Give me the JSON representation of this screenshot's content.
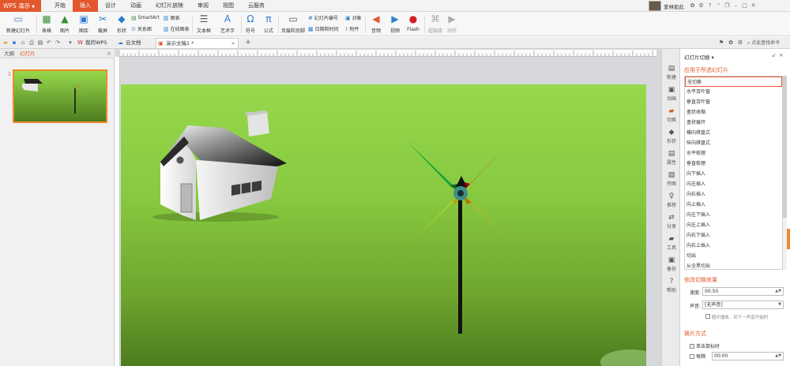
{
  "app": {
    "name": "WPS 演示"
  },
  "menu": {
    "tabs": [
      "开始",
      "插入",
      "设计",
      "动画",
      "幻灯片放映",
      "审阅",
      "视图",
      "云服务"
    ],
    "active_index": 1
  },
  "user": {
    "name": "爱林如此"
  },
  "ribbon": {
    "new_slide": "新建幻灯片",
    "table": "表格",
    "picture": "图片",
    "gallery": "图库",
    "screenshot": "截屏",
    "shapes": "形状",
    "smartart": "SmartArt",
    "chart": "图表",
    "relation": "关系图",
    "online_chart": "在线图表",
    "textbox": "文本框",
    "wordart": "艺术字",
    "symbol": "符号",
    "formula": "公式",
    "header_footer": "页眉和页脚",
    "slide_number": "幻灯片编号",
    "object": "对象",
    "datetime": "日期和时间",
    "attachment": "附件",
    "audio": "音频",
    "video": "视频",
    "flash": "Flash",
    "hyperlink": "超链接",
    "action": "动作"
  },
  "doc_tabs": {
    "tabs": [
      "我的WPS",
      "云文档",
      "演示文稿1 *"
    ],
    "active_index": 2,
    "search": "点此查找命令"
  },
  "thumbnail_panel": {
    "tabs": [
      "大纲",
      "幻灯片"
    ],
    "active_index": 1,
    "slide_number": "1"
  },
  "side_tools": [
    "新建",
    "动画",
    "切换",
    "形状",
    "属性",
    "传图",
    "推荐",
    "分享",
    "工具",
    "备份",
    "帮助"
  ],
  "transition_panel": {
    "title": "幻灯片切换",
    "apply_section": "应用于所选幻灯片",
    "items": [
      "无切换",
      "水平百叶窗",
      "垂直百叶窗",
      "盒状收缩",
      "盒状展开",
      "横向棋盘式",
      "纵向棋盘式",
      "水平梳理",
      "垂直梳理",
      "向下插入",
      "向左插入",
      "向右插入",
      "向上插入",
      "向左下插入",
      "向左上插入",
      "向右下插入",
      "向右上插入",
      "切出",
      "从全黑切出"
    ],
    "selected_index": 0,
    "modify_section": "修改切换效果",
    "speed_label": "速度:",
    "speed_value": "00.50",
    "sound_label": "声音:",
    "sound_value": "[无声音]",
    "loop_label": "循环播放，到下一声音开始时",
    "advance_section": "换片方式",
    "on_click_label": "单击鼠标时",
    "interval_label": "每隔",
    "interval_value": "00:00"
  },
  "colors": {
    "accent": "#e2572c",
    "slide_green": "#8fd24a",
    "pinwheel_green": "#1aa33a",
    "pinwheel_red": "#ff1a0a",
    "pinwheel_yellow": "#ffe600",
    "pinwheel_orange": "#ffb000"
  }
}
